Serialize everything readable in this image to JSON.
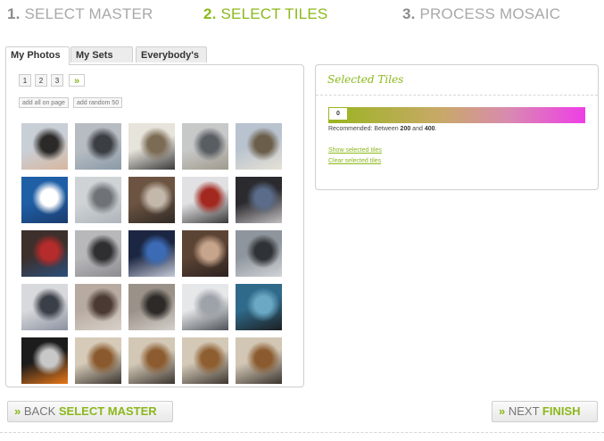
{
  "steps": [
    {
      "num": "1.",
      "label": "SELECT MASTER",
      "state": "inactive"
    },
    {
      "num": "2.",
      "label": "SELECT TILES",
      "state": "active"
    },
    {
      "num": "3.",
      "label": "PROCESS MOSAIC",
      "state": "inactive"
    }
  ],
  "tabs": [
    "My Photos",
    "My Sets",
    "Everybody's"
  ],
  "pager": {
    "pages": [
      "1",
      "2",
      "3"
    ],
    "next": "»"
  },
  "actions": {
    "add_all": "add all on page",
    "add_random": "add random 50"
  },
  "photos": {
    "rows": [
      [
        {
          "desc": "man speaking at podium",
          "colors": [
            "#c9cfd6",
            "#2c2a28",
            "#d8b7a0"
          ]
        },
        {
          "desc": "device on table",
          "colors": [
            "#b7bcc2",
            "#3b3e43",
            "#8a9aa8"
          ]
        },
        {
          "desc": "conference room panel",
          "colors": [
            "#e7e4dc",
            "#7d6c55",
            "#3a3a3a"
          ]
        },
        {
          "desc": "stage presentation",
          "colors": [
            "#c7c9c9",
            "#595e63",
            "#a09a8c"
          ]
        },
        {
          "desc": "speaker with audience",
          "colors": [
            "#b9c3cf",
            "#6b5e4a",
            "#e6e1d5"
          ]
        }
      ],
      [
        {
          "desc": "wifi sign",
          "colors": [
            "#1f5fa6",
            "#ffffff",
            "#1a3b6e"
          ]
        },
        {
          "desc": "ceiling banners",
          "colors": [
            "#cfd3d6",
            "#6f7378",
            "#aeb4ba"
          ]
        },
        {
          "desc": "crowd in hall",
          "colors": [
            "#6d5442",
            "#c3b8aa",
            "#2f2925"
          ]
        },
        {
          "desc": "laptop user red shirt",
          "colors": [
            "#e1e1e3",
            "#a3281f",
            "#3a3a3a"
          ]
        },
        {
          "desc": "audience at screen",
          "colors": [
            "#2b2a2e",
            "#5a6c8a",
            "#c2bfc1"
          ]
        }
      ],
      [
        {
          "desc": "people in red",
          "colors": [
            "#3d2f2b",
            "#b62b2b",
            "#2c4f7a"
          ]
        },
        {
          "desc": "large crowd hall",
          "colors": [
            "#b8b8bb",
            "#2f2e30",
            "#8c8c90"
          ]
        },
        {
          "desc": "tv screen sports",
          "colors": [
            "#1b2642",
            "#3c6bb5",
            "#c5c9d8"
          ]
        },
        {
          "desc": "man portrait",
          "colors": [
            "#5c4434",
            "#c7a58c",
            "#2d2220"
          ]
        },
        {
          "desc": "laptops on table",
          "colors": [
            "#8e959c",
            "#2f3236",
            "#d1d4d8"
          ]
        }
      ],
      [
        {
          "desc": "auditorium stage",
          "colors": [
            "#d8d9dc",
            "#3a3f48",
            "#8b91a0"
          ]
        },
        {
          "desc": "audience crowd",
          "colors": [
            "#b7aaa0",
            "#4a3a33",
            "#d9d2ca"
          ]
        },
        {
          "desc": "arched hall",
          "colors": [
            "#9a9188",
            "#2d2a28",
            "#d4d0cb"
          ]
        },
        {
          "desc": "projection screen",
          "colors": [
            "#e6e7e8",
            "#9ea3aa",
            "#4d5259"
          ]
        },
        {
          "desc": "phone screen photo",
          "colors": [
            "#2f6a8a",
            "#6aa8c4",
            "#1d1f22"
          ]
        }
      ],
      [
        {
          "desc": "robot figure",
          "colors": [
            "#1c1c1c",
            "#c8c8c8",
            "#e8781a"
          ]
        },
        {
          "desc": "dog behind window",
          "colors": [
            "#d6cbb8",
            "#8a5a2e",
            "#3a342e"
          ]
        },
        {
          "desc": "dog behind window",
          "colors": [
            "#d3c8b6",
            "#8c5c30",
            "#3b352f"
          ]
        },
        {
          "desc": "dog behind window",
          "colors": [
            "#d4c9b7",
            "#8e5e31",
            "#3c3630"
          ]
        },
        {
          "desc": "dog behind window",
          "colors": [
            "#d2c7b5",
            "#8b5b2f",
            "#3a342e"
          ]
        }
      ]
    ]
  },
  "selected": {
    "title": "Selected Tiles",
    "count": "0",
    "recommend_prefix": "Recommended: Between ",
    "recommend_min": "200",
    "recommend_mid": " and ",
    "recommend_max": "400",
    "recommend_suffix": ".",
    "show_link": "Show selected tiles",
    "clear_link": "Clear selected tiles",
    "progress_fraction": 0
  },
  "nav": {
    "back_chev": "»",
    "back_plain": "BACK ",
    "back_strong": "SELECT MASTER",
    "next_chev": "»",
    "next_plain": "NEXT ",
    "next_strong": "FINISH"
  },
  "colors": {
    "accent": "#8cb81c",
    "gradient_end": "#ee3ee6"
  }
}
